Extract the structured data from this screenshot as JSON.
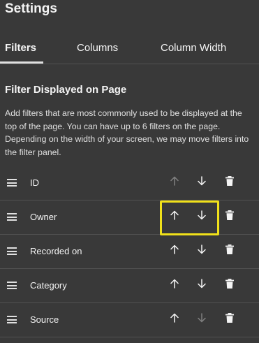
{
  "panel": {
    "title": "Settings"
  },
  "tabs": [
    {
      "label": "Filters",
      "active": true
    },
    {
      "label": "Columns",
      "active": false
    },
    {
      "label": "Column Width",
      "active": false
    }
  ],
  "section": {
    "title": "Filter Displayed on Page",
    "description": "Add filters that are most commonly used to be displayed at the top of the page. You can have up to 6 filters on the page. Depending on the width of your screen, we may move filters into the filter panel."
  },
  "filters": [
    {
      "label": "ID",
      "up_enabled": false,
      "down_enabled": true
    },
    {
      "label": "Owner",
      "up_enabled": true,
      "down_enabled": true,
      "highlighted": true
    },
    {
      "label": "Recorded on",
      "up_enabled": true,
      "down_enabled": true
    },
    {
      "label": "Category",
      "up_enabled": true,
      "down_enabled": true
    },
    {
      "label": "Source",
      "up_enabled": true,
      "down_enabled": false
    }
  ],
  "icons": {
    "drag": "drag-handle-icon",
    "up": "arrow-up-icon",
    "down": "arrow-down-icon",
    "delete": "trash-icon"
  },
  "colors": {
    "background": "#393939",
    "text": "#f4f4f4",
    "divider": "#525252",
    "highlight": "#f1e11a"
  }
}
